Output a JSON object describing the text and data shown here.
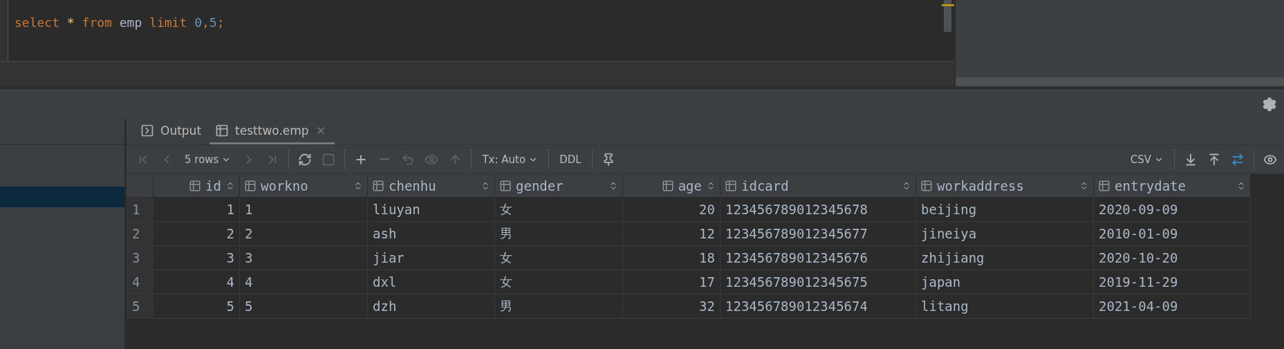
{
  "editor": {
    "tokens": [
      {
        "text": "select ",
        "kind": "keyword"
      },
      {
        "text": "* ",
        "kind": "star"
      },
      {
        "text": "from ",
        "kind": "keyword"
      },
      {
        "text": "emp ",
        "kind": "ident"
      },
      {
        "text": "limit ",
        "kind": "keyword"
      },
      {
        "text": "0",
        "kind": "number"
      },
      {
        "text": ",",
        "kind": "keyword"
      },
      {
        "text": "5",
        "kind": "number"
      },
      {
        "text": ";",
        "kind": "keyword"
      }
    ]
  },
  "tabs": [
    {
      "label": "Output",
      "kind": "output",
      "selected": false,
      "closable": false
    },
    {
      "label": "testtwo.emp",
      "kind": "table",
      "selected": true,
      "closable": true
    }
  ],
  "toolbar": {
    "left": [
      {
        "kind": "first",
        "disabled": true
      },
      {
        "kind": "prev",
        "disabled": true
      },
      {
        "kind": "dropdown",
        "label": "5 rows",
        "disabled": false
      },
      {
        "kind": "next",
        "disabled": true
      },
      {
        "kind": "last",
        "disabled": true
      },
      {
        "kind": "separator"
      },
      {
        "kind": "refresh",
        "disabled": false
      },
      {
        "kind": "stop",
        "disabled": true
      },
      {
        "kind": "separator"
      },
      {
        "kind": "add",
        "disabled": false
      },
      {
        "kind": "remove",
        "disabled": true
      },
      {
        "kind": "revert",
        "disabled": true
      },
      {
        "kind": "preview",
        "disabled": true
      },
      {
        "kind": "submit",
        "disabled": true
      },
      {
        "kind": "separator"
      },
      {
        "kind": "dropdown",
        "label": "Tx: Auto",
        "disabled": false
      },
      {
        "kind": "separator"
      },
      {
        "kind": "text",
        "label": "DDL",
        "disabled": false
      },
      {
        "kind": "separator"
      },
      {
        "kind": "pin",
        "disabled": false
      }
    ],
    "right": [
      {
        "kind": "dropdown",
        "label": "CSV",
        "disabled": false
      },
      {
        "kind": "separator"
      },
      {
        "kind": "download",
        "disabled": false
      },
      {
        "kind": "upload",
        "disabled": false
      },
      {
        "kind": "compare",
        "disabled": false
      },
      {
        "kind": "separator"
      },
      {
        "kind": "view",
        "disabled": false
      }
    ]
  },
  "table": {
    "columns": [
      {
        "name": "id",
        "kind": "number"
      },
      {
        "name": "workno",
        "kind": "text"
      },
      {
        "name": "chenhu",
        "kind": "text"
      },
      {
        "name": "gender",
        "kind": "text"
      },
      {
        "name": "age",
        "kind": "number"
      },
      {
        "name": "idcard",
        "kind": "text"
      },
      {
        "name": "workaddress",
        "kind": "text"
      },
      {
        "name": "entrydate",
        "kind": "text"
      }
    ],
    "rows": [
      {
        "number": "1",
        "cells": [
          "1",
          "1",
          "liuyan",
          "女",
          "20",
          "123456789012345678",
          "beijing",
          "2020-09-09"
        ]
      },
      {
        "number": "2",
        "cells": [
          "2",
          "2",
          "ash",
          "男",
          "12",
          "123456789012345677",
          "jineiya",
          "2010-01-09"
        ]
      },
      {
        "number": "3",
        "cells": [
          "3",
          "3",
          "jiar",
          "女",
          "18",
          "123456789012345676",
          "zhijiang",
          "2020-10-20"
        ]
      },
      {
        "number": "4",
        "cells": [
          "4",
          "4",
          "dxl",
          "女",
          "17",
          "123456789012345675",
          "japan",
          "2019-11-29"
        ]
      },
      {
        "number": "5",
        "cells": [
          "5",
          "5",
          "dzh",
          "男",
          "32",
          "123456789012345674",
          "litang",
          "2021-04-09"
        ]
      }
    ]
  }
}
